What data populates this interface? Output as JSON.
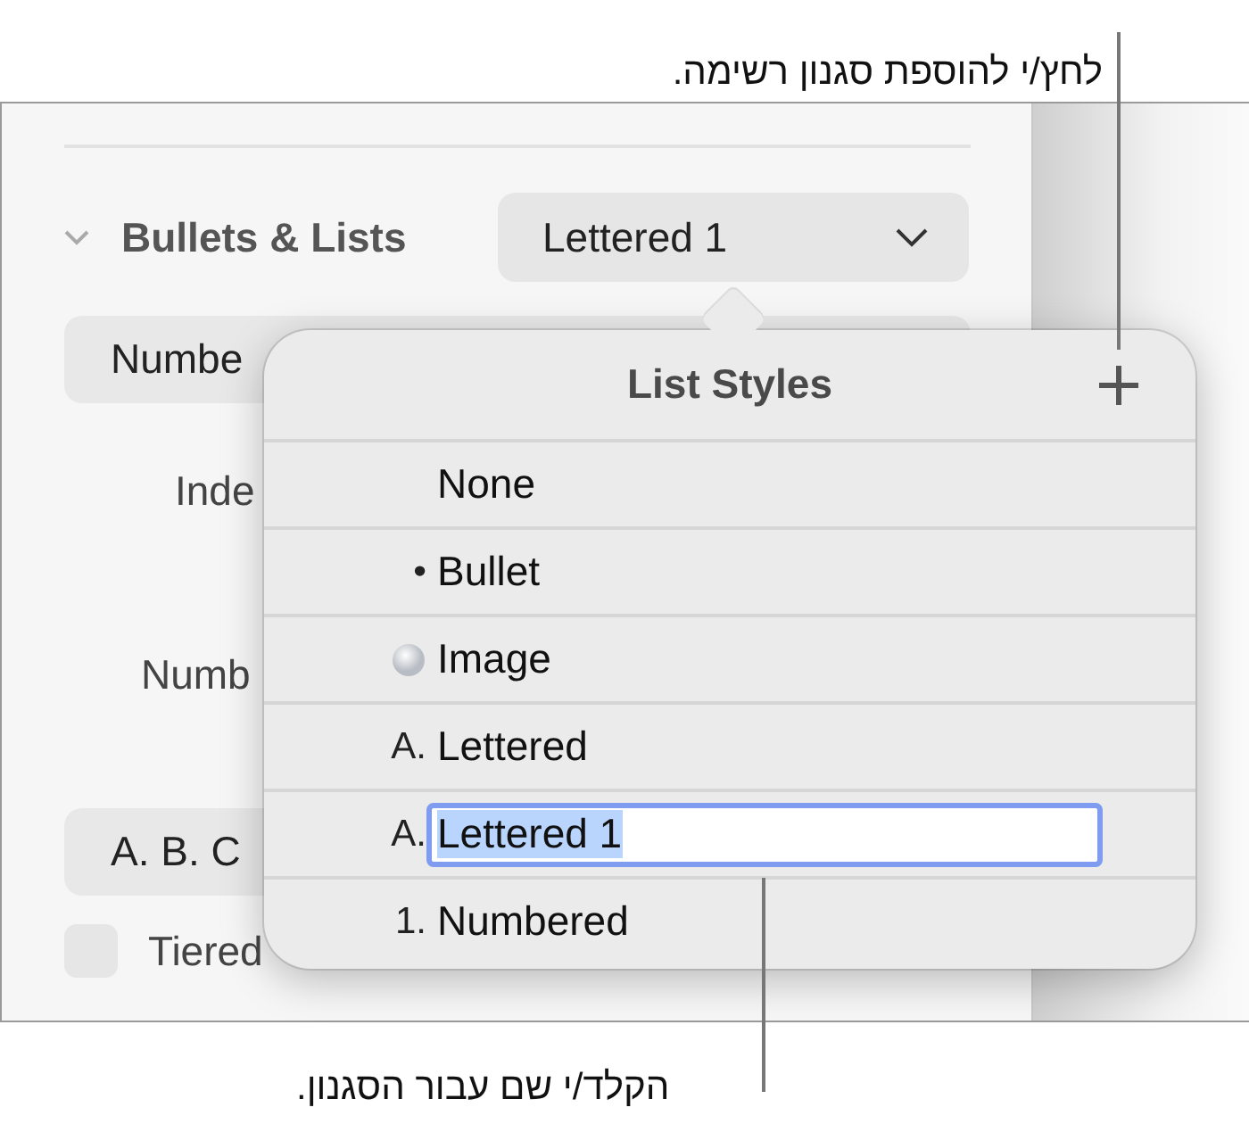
{
  "callout_top": "לחץ/י להוספת סגנון רשימה.",
  "callout_bottom": "הקלד/י שם עבור הסגנון.",
  "inspector": {
    "section": {
      "title": "Bullets & Lists",
      "expanded": true,
      "style_value": "Lettered 1"
    },
    "type_row": "Numbe",
    "indent_label": "Inde",
    "number_label": "Numb",
    "format_row": "A. B. C",
    "tiered_numbers": {
      "label": "Tiered",
      "checked": false
    }
  },
  "popover": {
    "title": "List Styles",
    "items": [
      {
        "kind": "plain",
        "name": "None",
        "editing": false
      },
      {
        "kind": "glyph",
        "marker": "•",
        "name": "Bullet",
        "editing": false
      },
      {
        "kind": "image",
        "name": "Image",
        "editing": false
      },
      {
        "kind": "glyph",
        "marker": "A.",
        "name": "Lettered",
        "editing": false
      },
      {
        "kind": "glyph",
        "marker": "A.",
        "name": "Lettered 1",
        "editing": true
      },
      {
        "kind": "glyph",
        "marker": "1.",
        "name": "Numbered",
        "editing": false
      }
    ]
  }
}
